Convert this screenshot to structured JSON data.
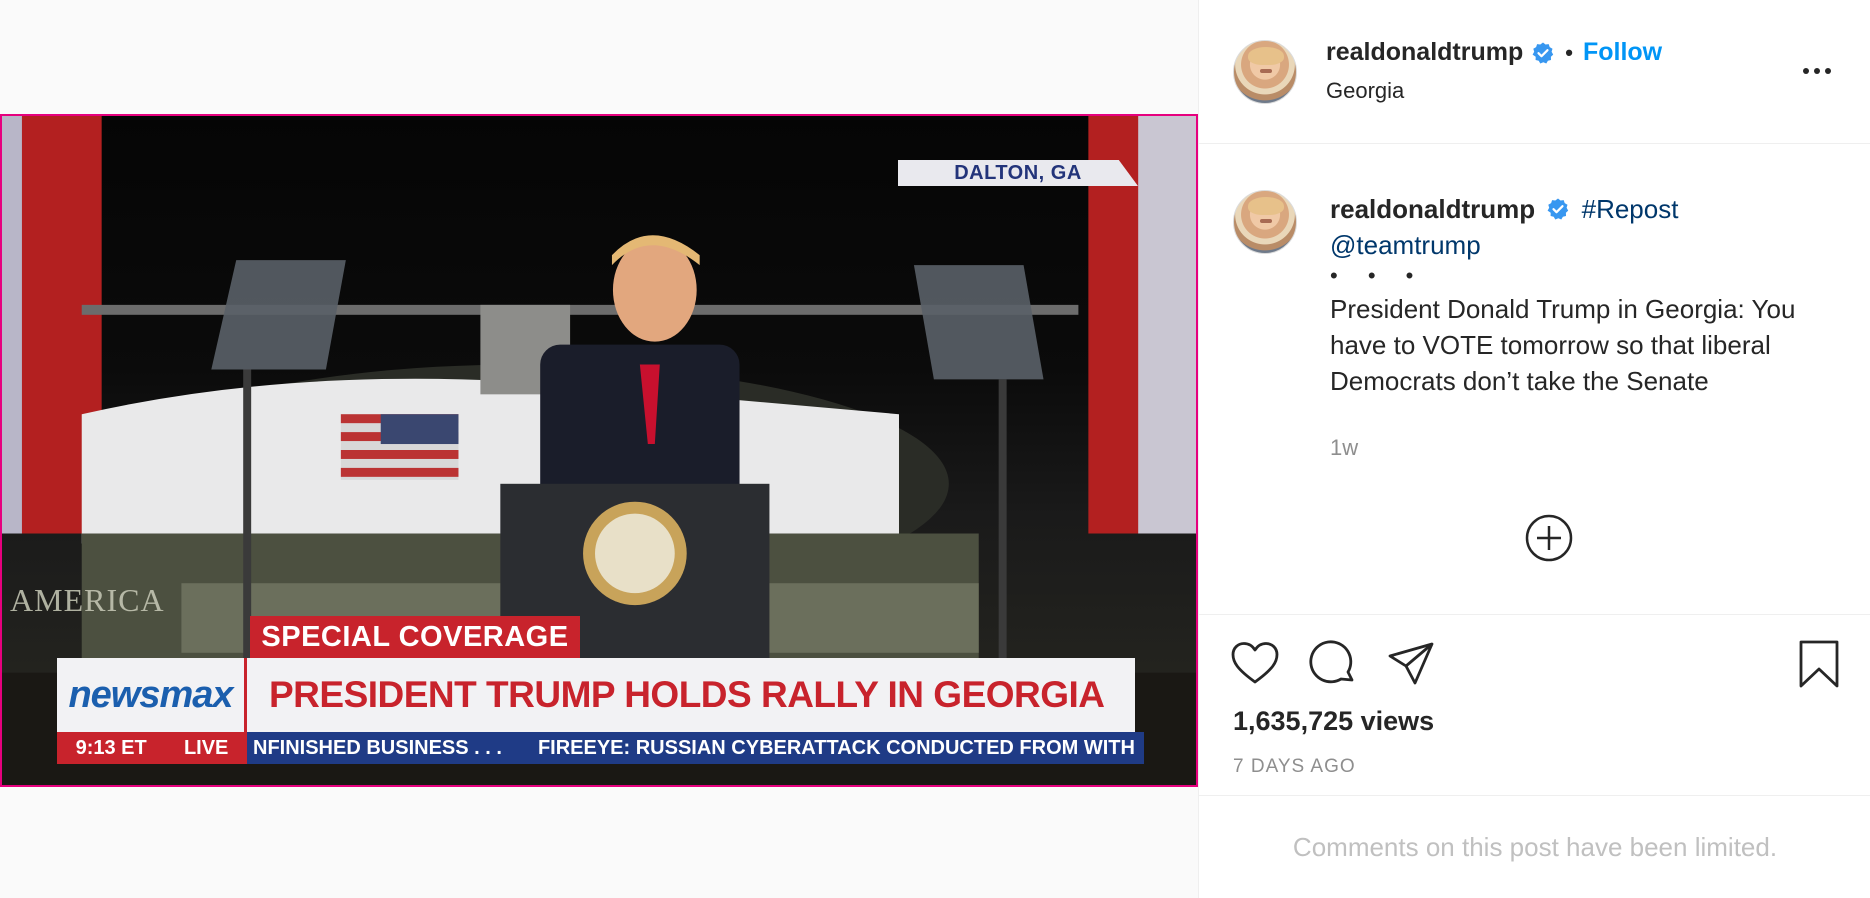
{
  "colors": {
    "accent": "#0095f6",
    "hashtag": "#00376b",
    "muted": "#8e8e8e",
    "video_border": "#e6007e",
    "network_red": "#c8232c",
    "network_blue": "#1f3b86"
  },
  "video": {
    "dateline": "DALTON, GA",
    "backdrop_text": "AMERICA",
    "special_label": "SPECIAL COVERAGE",
    "brand": "newsmax",
    "headline": "PRESIDENT TRUMP HOLDS RALLY IN GEORGIA",
    "ticker": {
      "time": "9:13 ET",
      "live": "LIVE",
      "item_1": "NFINISHED BUSINESS . . .",
      "item_2": "FIREEYE: RUSSIAN CYBERATTACK CONDUCTED FROM WITH"
    }
  },
  "header": {
    "username": "realdonaldtrump",
    "verified_icon": "verified-badge-icon",
    "separator": "•",
    "follow_label": "Follow",
    "location": "Georgia",
    "more_icon": "more-options-icon"
  },
  "caption": {
    "username": "realdonaldtrump",
    "hashtag": "#Repost",
    "mention": "@teamtrump",
    "dots": "• • •",
    "text": "President Donald Trump in Georgia: You have to VOTE tomorrow so that liberal Democrats don’t take the Senate",
    "time": "1w",
    "load_more_icon": "plus-circle-icon"
  },
  "actions": {
    "icons": [
      "heart-icon",
      "comment-icon",
      "share-icon",
      "bookmark-icon"
    ],
    "views": "1,635,725 views",
    "posted": "7 DAYS AGO"
  },
  "comments": {
    "limited_notice": "Comments on this post have been limited."
  }
}
